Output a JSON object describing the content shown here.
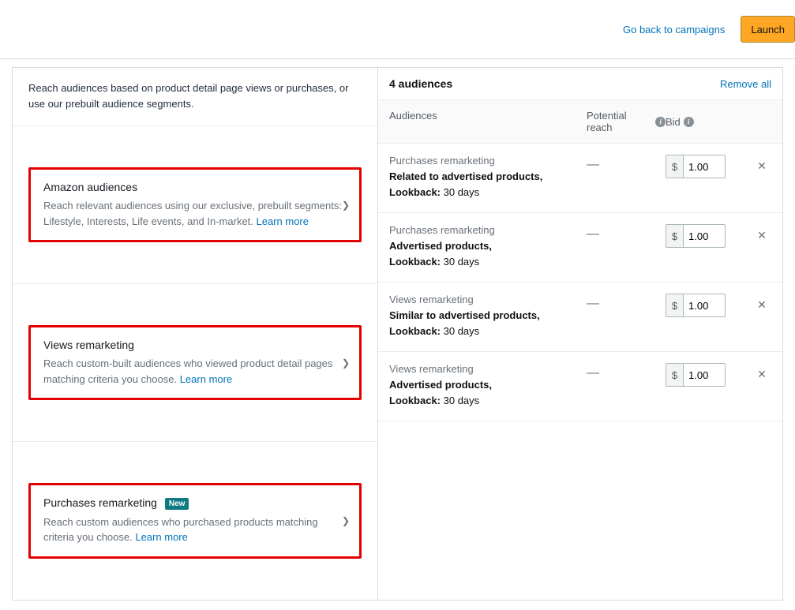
{
  "topbar": {
    "back_link": "Go back to campaigns",
    "launch_label": "Launch"
  },
  "left": {
    "intro": "Reach audiences based on product detail page views or purchases, or use our prebuilt audience segments.",
    "cards": [
      {
        "title": "Amazon audiences",
        "desc": "Reach relevant audiences using our exclusive, prebuilt segments: Lifestyle, Interests, Life events, and In-market. ",
        "learn": "Learn more",
        "badge": null
      },
      {
        "title": "Views remarketing",
        "desc": "Reach custom-built audiences who viewed product detail pages matching criteria you choose. ",
        "learn": "Learn more",
        "badge": null
      },
      {
        "title": "Purchases remarketing",
        "desc": "Reach custom audiences who purchased products matching criteria you choose. ",
        "learn": "Learn more",
        "badge": "New"
      }
    ]
  },
  "right": {
    "count_label": "4 audiences",
    "remove_all": "Remove all",
    "columns": {
      "audiences": "Audiences",
      "reach": "Potential reach",
      "bid": "Bid"
    },
    "currency": "$",
    "rows": [
      {
        "type": "Purchases remarketing",
        "line1": "Related to advertised products,",
        "lookback_label": "Lookback:",
        "lookback_value": " 30 days",
        "reach": "—",
        "bid": "1.00"
      },
      {
        "type": "Purchases remarketing",
        "line1": "Advertised products,",
        "lookback_label": "Lookback:",
        "lookback_value": " 30 days",
        "reach": "—",
        "bid": "1.00"
      },
      {
        "type": "Views remarketing",
        "line1": "Similar to advertised products,",
        "lookback_label": "Lookback:",
        "lookback_value": " 30 days",
        "reach": "—",
        "bid": "1.00"
      },
      {
        "type": "Views remarketing",
        "line1": "Advertised products,",
        "lookback_label": "Lookback:",
        "lookback_value": " 30 days",
        "reach": "—",
        "bid": "1.00"
      }
    ]
  }
}
